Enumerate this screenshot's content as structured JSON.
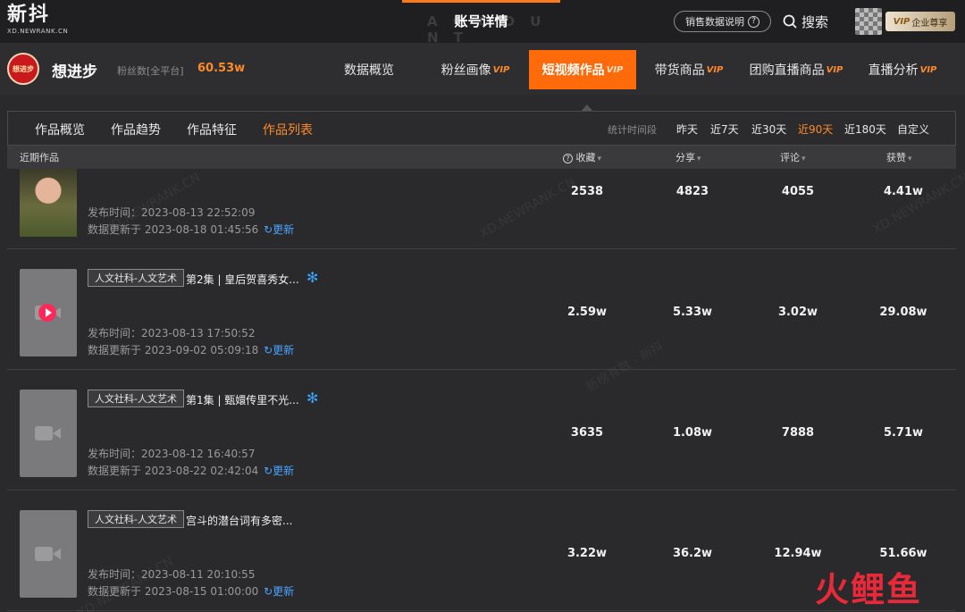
{
  "header": {
    "logo_main": "新抖",
    "logo_sub": "XD.NEWRANK.CN",
    "page_title": "账号详情",
    "page_title_ghost": "A C C O U N T",
    "sales_help": "销售数据说明",
    "help_icon": "?",
    "search": "搜索",
    "vip_badge_vip": "VIP",
    "vip_badge_text": "企业尊享"
  },
  "account": {
    "avatar_text": "想进步",
    "name": "想进步",
    "fans_label": "粉丝数[全平台]",
    "fans_value": "60.53w"
  },
  "nav": {
    "tabs": [
      {
        "label": "数据概览",
        "vip": ""
      },
      {
        "label": "粉丝画像",
        "vip": "VIP"
      },
      {
        "label": "短视频作品",
        "vip": "VIP"
      },
      {
        "label": "带货商品",
        "vip": "VIP"
      },
      {
        "label": "团购直播商品",
        "vip": "VIP"
      },
      {
        "label": "直播分析",
        "vip": "VIP"
      }
    ]
  },
  "subnav": {
    "tabs": [
      "作品概览",
      "作品趋势",
      "作品特征",
      "作品列表"
    ],
    "period_label": "统计时间段",
    "periods": [
      "昨天",
      "近7天",
      "近30天",
      "近90天",
      "近180天",
      "自定义"
    ]
  },
  "table": {
    "header": {
      "recent": "近期作品",
      "collect": "收藏",
      "share": "分享",
      "comment": "评论",
      "like": "获赞",
      "help_icon": "?",
      "sort_icon": "▾"
    },
    "refresh_icon": "↻",
    "rows": [
      {
        "tag": "",
        "title": "",
        "pub": "发布时间：2023-08-13 22:52:09",
        "upd": "数据更新于 2023-08-18 01:45:56",
        "upd_link": "更新",
        "collect": "2538",
        "share": "4823",
        "comment": "4055",
        "like": "4.41w"
      },
      {
        "tag": "人文社科-人文艺术",
        "title": "第2集 | 皇后贺喜秀女...",
        "pub": "发布时间：2023-08-13 17:50:52",
        "upd": "数据更新于 2023-09-02 05:09:18",
        "upd_link": "更新",
        "collect": "2.59w",
        "share": "5.33w",
        "comment": "3.02w",
        "like": "29.08w"
      },
      {
        "tag": "人文社科-人文艺术",
        "title": "第1集 | 甄嬛传里不光...",
        "pub": "发布时间：2023-08-12 16:40:57",
        "upd": "数据更新于 2023-08-22 02:42:04",
        "upd_link": "更新",
        "collect": "3635",
        "share": "1.08w",
        "comment": "7888",
        "like": "5.71w"
      },
      {
        "tag": "人文社科-人文艺术",
        "title": "宫斗的潜台词有多密...",
        "pub": "发布时间：2023-08-11 20:10:55",
        "upd": "数据更新于 2023-08-15 01:00:00",
        "upd_link": "更新",
        "collect": "3.22w",
        "share": "36.2w",
        "comment": "12.94w",
        "like": "51.66w"
      }
    ],
    "snow_icon": "✻"
  },
  "watermarks": {
    "a": "XD.NEWRANK.CN",
    "b": "新榜有数 · 新抖"
  },
  "corner_logo": "火鲤鱼",
  "colors": {
    "accent": "#ff6a0b",
    "accent_text": "#ff8a2a",
    "link": "#4aa3ff",
    "corner_logo": "#e8293a"
  }
}
